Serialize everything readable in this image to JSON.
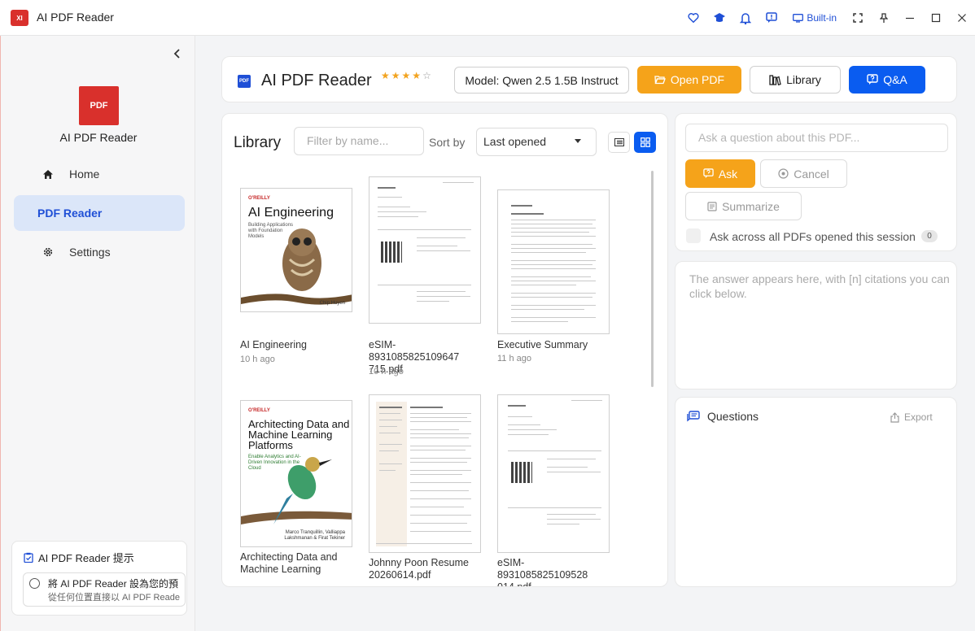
{
  "titlebar": {
    "badge": "XI",
    "app_title": "AI PDF Reader",
    "builtin_label": "Built-in",
    "icons": [
      "heart-icon",
      "graduation-cap-icon",
      "bell-icon",
      "feedback-icon",
      "monitor-icon",
      "fullscreen-icon",
      "pin-icon"
    ]
  },
  "sidebar": {
    "logo_text": "PDF",
    "app_name": "AI PDF Reader",
    "items": [
      {
        "label": "Home",
        "icon": "home-icon"
      },
      {
        "label": "PDF Reader",
        "icon": ""
      },
      {
        "label": "Settings",
        "icon": "gear-icon"
      }
    ],
    "tip": {
      "title": "AI PDF Reader 提示",
      "line1": "將 AI PDF Reader 設為您的預",
      "line2": "從任何位置直接以 AI PDF Reade"
    }
  },
  "header": {
    "icon_text": "PDF",
    "title": "AI PDF Reader",
    "rating": 4,
    "model_label": "Model: Qwen 2.5 1.5B Instruct",
    "open_pdf": "Open PDF",
    "library": "Library",
    "qa": "Q&A"
  },
  "library": {
    "title": "Library",
    "filter_placeholder": "Filter by name...",
    "sort_label": "Sort by",
    "sort_value": "Last opened",
    "items": [
      {
        "name": "AI Engineering",
        "time": "10 h ago",
        "cover_title": "AI Engineering",
        "cover_sub": "Building Applications with Foundation Models",
        "cover_author": "Chip Huyen",
        "publisher": "O'REILLY"
      },
      {
        "name": "eSIM-8931085825109647 715.pdf",
        "time": "10 h ago"
      },
      {
        "name": "Executive Summary",
        "time": "11 h ago"
      },
      {
        "name": "Architecting Data and Machine Learning",
        "time": "",
        "cover_title": "Architecting Data and Machine Learning Platforms",
        "cover_sub": "Enable Analytics and AI-Driven Innovation in the Cloud",
        "cover_author": "Marco Tranquillin, Valliappa Lakshmanan & Firat Tekiner",
        "publisher": "O'REILLY"
      },
      {
        "name": "Johnny Poon Resume 20260614.pdf",
        "time": ""
      },
      {
        "name": "eSIM-8931085825109528 014.pdf",
        "time": ""
      }
    ]
  },
  "qa_panel": {
    "ask_placeholder": "Ask a question about this PDF...",
    "ask": "Ask",
    "cancel": "Cancel",
    "summarize": "Summarize",
    "across_label": "Ask across all PDFs opened this session",
    "across_count": "0",
    "answer_placeholder": "The answer appears here, with [n] citations you can click below.",
    "questions_title": "Questions",
    "export": "Export"
  },
  "colors": {
    "accent_blue": "#0a5cf0",
    "accent_orange": "#f5a31a",
    "brand_red": "#d9302c"
  }
}
